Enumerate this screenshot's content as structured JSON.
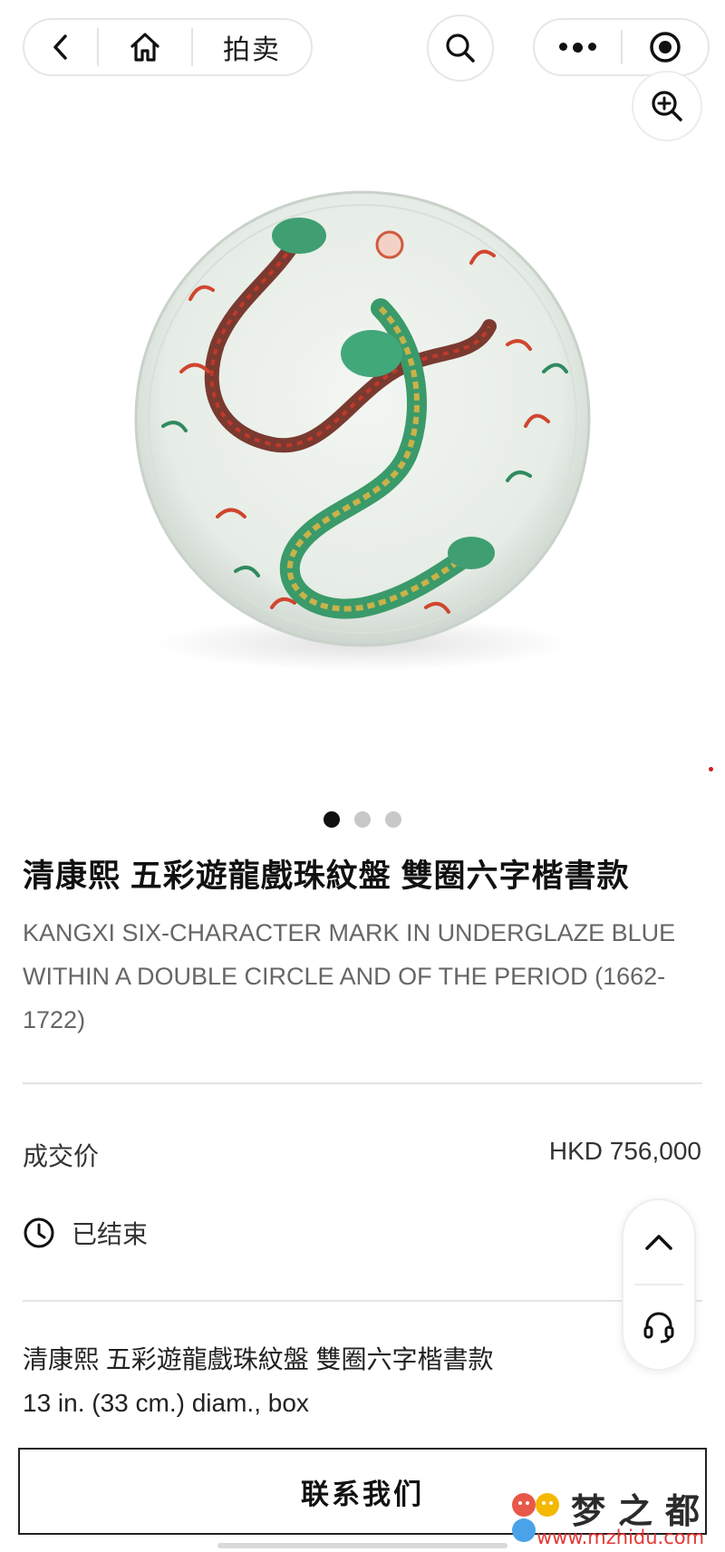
{
  "nav": {
    "title": "拍卖"
  },
  "gallery": {
    "image_alt": "dragon plate",
    "slide_count": 3,
    "active_slide": 1
  },
  "lot": {
    "title_cn": "清康熙 五彩遊龍戲珠紋盤 雙圈六字楷書款",
    "subtitle_en": "KANGXI SIX-CHARACTER MARK IN UNDERGLAZE BLUE WITHIN A DOUBLE CIRCLE AND OF THE PERIOD (1662-1722)",
    "price_label": "成交价",
    "price_value": "HKD 756,000",
    "status": "已结束",
    "desc_line1": "清康熙 五彩遊龍戲珠紋盤 雙圈六字楷書款",
    "desc_line2": "13 in. (33 cm.) diam., box"
  },
  "footer": {
    "contact_label": "联系我们"
  },
  "watermark": {
    "name": "梦之都",
    "url": "www.mzhidu.com"
  },
  "colors": {
    "text": "#1a1a1a",
    "muted": "#666666",
    "border": "#e6e6e6",
    "watermark_red": "#e53935"
  }
}
